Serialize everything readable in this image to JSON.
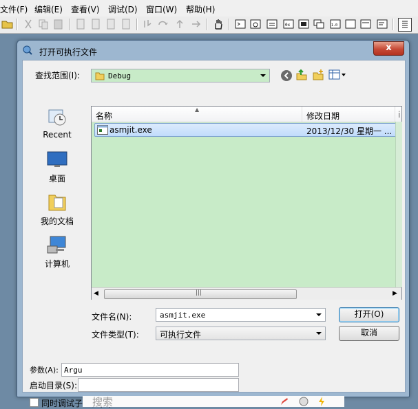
{
  "menu": [
    "文件(F)",
    "编辑(E)",
    "查看(V)",
    "调试(D)",
    "窗口(W)",
    "帮助(H)"
  ],
  "dialog": {
    "title": "打开可执行文件",
    "close_label": "x",
    "look_in_label": "查找范围(I):",
    "look_in_value": "Debug",
    "places": [
      "Recent",
      "桌面",
      "我的文档",
      "计算机"
    ],
    "columns": [
      "名称",
      "修改日期",
      "i"
    ],
    "files": [
      {
        "name": "asmjit.exe",
        "modified": "2013/12/30 星期一 ...",
        "extra": "["
      }
    ],
    "filename_label": "文件名(N):",
    "filename_value": "asmjit.exe",
    "filetype_label": "文件类型(T):",
    "filetype_value": "可执行文件",
    "open_button": "打开(O)",
    "cancel_button": "取消",
    "args_label": "参数(A):",
    "args_value": "Argu",
    "startdir_label": "启动目录(S):",
    "startdir_value": "",
    "child_debug_label": "同时调试子进程(D)",
    "child_debug_checked": false
  },
  "search_text": "搜索"
}
